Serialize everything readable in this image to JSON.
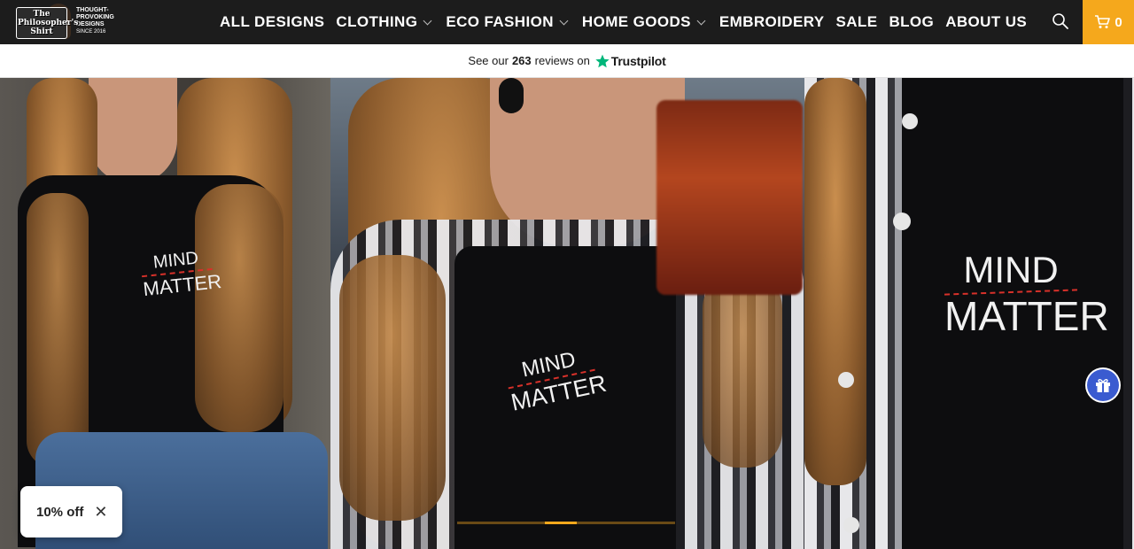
{
  "brand": {
    "logo_text": "The Philosopher's Shirt",
    "tagline": "THOUGHT-PROVOKING DESIGNS",
    "since": "SINCE 2016"
  },
  "nav": {
    "items": [
      {
        "label": "ALL DESIGNS",
        "dropdown": false
      },
      {
        "label": "CLOTHING",
        "dropdown": true
      },
      {
        "label": "ECO FASHION",
        "dropdown": true
      },
      {
        "label": "HOME GOODS",
        "dropdown": true
      },
      {
        "label": "EMBROIDERY",
        "dropdown": false
      },
      {
        "label": "SALE",
        "dropdown": false
      },
      {
        "label": "BLOG",
        "dropdown": false
      },
      {
        "label": "ABOUT US",
        "dropdown": false
      }
    ],
    "search_icon": "search-icon",
    "cart_count": "0"
  },
  "trust": {
    "prefix": "See our",
    "count": "263",
    "suffix": "reviews on",
    "brand": "Trustpilot",
    "star_color": "#00b67a"
  },
  "hero": {
    "print_line1": "MIND",
    "print_line2": "MATTER",
    "slide_progress": 0.47
  },
  "discount": {
    "label": "10% off"
  },
  "colors": {
    "header_bg": "#1c1c1c",
    "accent": "#f5a81c",
    "gift_button": "#3a5bd0"
  }
}
